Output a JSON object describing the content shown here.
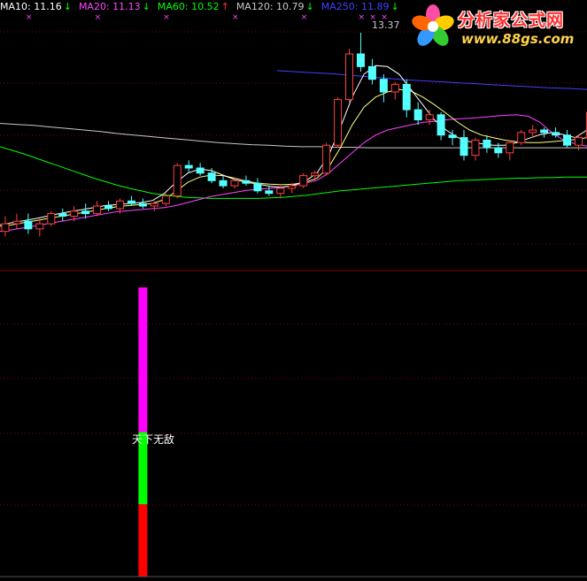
{
  "legend": [
    {
      "label": "MA10: 11.16",
      "arrow": "↓",
      "color": "#ffffff",
      "arrow_color": "#00ff00"
    },
    {
      "label": "MA20: 11.13",
      "arrow": "↓",
      "color": "#ff44ff",
      "arrow_color": "#00ff00"
    },
    {
      "label": "MA60: 10.52",
      "arrow": "↑",
      "color": "#00ff00",
      "arrow_color": "#ff3030"
    },
    {
      "label": "MA120: 10.79",
      "arrow": "↓",
      "color": "#c8c8c8",
      "arrow_color": "#00ff00"
    },
    {
      "label": "MA250: 11.89",
      "arrow": "↓",
      "color": "#4040ff",
      "arrow_color": "#00ff00"
    }
  ],
  "logo": {
    "title": "分析家公式网",
    "url": "www.88gs.com",
    "icon": "flower-logo-icon"
  },
  "colors": {
    "background": "#000000",
    "grid": "#8b0000",
    "up_candle": "#ff4040",
    "down_candle": "#54ffff",
    "ma_short": "#ffffff",
    "ma_yellow": "#ffff80",
    "ma20": "#ff44ff",
    "ma60": "#00ff00",
    "ma120": "#c8c8c8",
    "ma250": "#4040ff",
    "bar_magenta": "#ff00ff",
    "bar_green": "#00ff00",
    "bar_red": "#ff0000"
  },
  "chart_data": [
    {
      "type": "candlestick",
      "peak_label": "13.37",
      "y_range": [
        9.2,
        13.7
      ],
      "candles": [
        {
          "o": 9.45,
          "h": 9.75,
          "l": 9.35,
          "c": 9.6
        },
        {
          "o": 9.6,
          "h": 9.8,
          "l": 9.5,
          "c": 9.65
        },
        {
          "o": 9.65,
          "h": 9.8,
          "l": 9.4,
          "c": 9.5
        },
        {
          "o": 9.5,
          "h": 9.7,
          "l": 9.35,
          "c": 9.6
        },
        {
          "o": 9.6,
          "h": 9.85,
          "l": 9.55,
          "c": 9.8
        },
        {
          "o": 9.8,
          "h": 9.9,
          "l": 9.65,
          "c": 9.75
        },
        {
          "o": 9.75,
          "h": 9.95,
          "l": 9.65,
          "c": 9.85
        },
        {
          "o": 9.85,
          "h": 10.0,
          "l": 9.7,
          "c": 9.8
        },
        {
          "o": 9.8,
          "h": 10.05,
          "l": 9.75,
          "c": 9.95
        },
        {
          "o": 9.95,
          "h": 10.05,
          "l": 9.85,
          "c": 9.9
        },
        {
          "o": 9.9,
          "h": 10.1,
          "l": 9.8,
          "c": 10.05
        },
        {
          "o": 10.05,
          "h": 10.15,
          "l": 9.95,
          "c": 10.0
        },
        {
          "o": 10.0,
          "h": 10.1,
          "l": 9.9,
          "c": 9.95
        },
        {
          "o": 9.95,
          "h": 10.05,
          "l": 9.85,
          "c": 10.0
        },
        {
          "o": 10.0,
          "h": 10.2,
          "l": 9.95,
          "c": 10.15
        },
        {
          "o": 10.15,
          "h": 10.8,
          "l": 10.1,
          "c": 10.75
        },
        {
          "o": 10.75,
          "h": 10.85,
          "l": 10.6,
          "c": 10.7
        },
        {
          "o": 10.7,
          "h": 10.8,
          "l": 10.55,
          "c": 10.6
        },
        {
          "o": 10.6,
          "h": 10.7,
          "l": 10.4,
          "c": 10.45
        },
        {
          "o": 10.45,
          "h": 10.55,
          "l": 10.3,
          "c": 10.35
        },
        {
          "o": 10.35,
          "h": 10.5,
          "l": 10.3,
          "c": 10.45
        },
        {
          "o": 10.45,
          "h": 10.55,
          "l": 10.35,
          "c": 10.4
        },
        {
          "o": 10.4,
          "h": 10.5,
          "l": 10.2,
          "c": 10.25
        },
        {
          "o": 10.25,
          "h": 10.35,
          "l": 10.15,
          "c": 10.2
        },
        {
          "o": 10.2,
          "h": 10.35,
          "l": 10.1,
          "c": 10.3
        },
        {
          "o": 10.3,
          "h": 10.4,
          "l": 10.2,
          "c": 10.35
        },
        {
          "o": 10.35,
          "h": 10.6,
          "l": 10.3,
          "c": 10.55
        },
        {
          "o": 10.55,
          "h": 10.65,
          "l": 10.45,
          "c": 10.6
        },
        {
          "o": 10.6,
          "h": 11.2,
          "l": 10.55,
          "c": 11.15
        },
        {
          "o": 11.15,
          "h": 12.1,
          "l": 11.1,
          "c": 12.05
        },
        {
          "o": 12.05,
          "h": 13.05,
          "l": 12.0,
          "c": 12.95
        },
        {
          "o": 12.95,
          "h": 13.37,
          "l": 12.6,
          "c": 12.7
        },
        {
          "o": 12.7,
          "h": 12.85,
          "l": 12.35,
          "c": 12.45
        },
        {
          "o": 12.45,
          "h": 12.55,
          "l": 12.0,
          "c": 12.2
        },
        {
          "o": 12.2,
          "h": 12.4,
          "l": 12.05,
          "c": 12.35
        },
        {
          "o": 12.35,
          "h": 12.45,
          "l": 11.7,
          "c": 11.85
        },
        {
          "o": 11.85,
          "h": 12.0,
          "l": 11.55,
          "c": 11.65
        },
        {
          "o": 11.65,
          "h": 11.85,
          "l": 11.55,
          "c": 11.75
        },
        {
          "o": 11.75,
          "h": 11.8,
          "l": 11.25,
          "c": 11.35
        },
        {
          "o": 11.35,
          "h": 11.45,
          "l": 11.15,
          "c": 11.3
        },
        {
          "o": 11.3,
          "h": 11.45,
          "l": 10.85,
          "c": 10.95
        },
        {
          "o": 10.95,
          "h": 11.3,
          "l": 10.85,
          "c": 11.25
        },
        {
          "o": 11.25,
          "h": 11.35,
          "l": 11.0,
          "c": 11.1
        },
        {
          "o": 11.1,
          "h": 11.2,
          "l": 10.9,
          "c": 11.0
        },
        {
          "o": 11.0,
          "h": 11.25,
          "l": 10.85,
          "c": 11.2
        },
        {
          "o": 11.2,
          "h": 11.45,
          "l": 11.15,
          "c": 11.4
        },
        {
          "o": 11.4,
          "h": 11.55,
          "l": 11.3,
          "c": 11.45
        },
        {
          "o": 11.45,
          "h": 11.5,
          "l": 11.3,
          "c": 11.4
        },
        {
          "o": 11.4,
          "h": 11.5,
          "l": 11.3,
          "c": 11.35
        },
        {
          "o": 11.35,
          "h": 11.45,
          "l": 11.1,
          "c": 11.15
        },
        {
          "o": 11.15,
          "h": 11.35,
          "l": 11.05,
          "c": 11.3
        },
        {
          "o": 11.3,
          "h": 11.85,
          "l": 11.25,
          "c": 11.8
        }
      ],
      "ma_series": [
        {
          "key": "ma250",
          "values": [
            12.62,
            12.6,
            12.58,
            12.56,
            12.53,
            12.5,
            12.47,
            12.44,
            12.42,
            12.4,
            12.38,
            12.36,
            12.34,
            12.32,
            12.3,
            12.28,
            12.27,
            12.25
          ]
        },
        {
          "key": "ma120",
          "values": [
            11.58,
            11.56,
            11.54,
            11.51,
            11.48,
            11.45,
            11.42,
            11.38,
            11.35,
            11.32,
            11.29,
            11.26,
            11.23,
            11.2,
            11.18,
            11.16,
            11.15,
            11.13,
            11.12,
            11.12,
            11.11,
            11.11,
            11.1,
            11.1,
            11.1,
            11.1,
            11.1,
            11.1,
            11.1,
            11.1,
            11.1,
            11.1,
            11.1,
            11.1,
            11.1,
            11.1
          ]
        },
        {
          "key": "ma60",
          "values": [
            11.12,
            11.05,
            10.98,
            10.9,
            10.82,
            10.74,
            10.66,
            10.58,
            10.5,
            10.43,
            10.36,
            10.3,
            10.25,
            10.2,
            10.17,
            10.14,
            10.12,
            10.11,
            10.1,
            10.1,
            10.1,
            10.1,
            10.1,
            10.11,
            10.12,
            10.14,
            10.16,
            10.19,
            10.22,
            10.25,
            10.27,
            10.29,
            10.31,
            10.33,
            10.35,
            10.37,
            10.39,
            10.41,
            10.43,
            10.45,
            10.46,
            10.47,
            10.48,
            10.49,
            10.5,
            10.5,
            10.51,
            10.51,
            10.52,
            10.52,
            10.52
          ]
        },
        {
          "key": "ma20",
          "values": [
            9.45,
            9.48,
            9.52,
            9.56,
            9.6,
            9.64,
            9.68,
            9.72,
            9.76,
            9.8,
            9.84,
            9.86,
            9.88,
            9.9,
            9.92,
            9.96,
            10.02,
            10.08,
            10.14,
            10.18,
            10.22,
            10.26,
            10.28,
            10.3,
            10.32,
            10.35,
            10.4,
            10.46,
            10.6,
            10.8,
            11.0,
            11.2,
            11.35,
            11.45,
            11.5,
            11.55,
            11.6,
            11.62,
            11.65,
            11.67,
            11.68,
            11.7,
            11.72,
            11.74,
            11.75,
            11.72,
            11.6,
            11.4,
            11.25,
            11.18,
            11.13
          ]
        },
        {
          "key": "ma_yellow",
          "values": [
            9.55,
            9.58,
            9.62,
            9.66,
            9.7,
            9.74,
            9.78,
            9.82,
            9.86,
            9.9,
            9.94,
            9.96,
            9.98,
            10.0,
            10.08,
            10.24,
            10.42,
            10.52,
            10.56,
            10.55,
            10.5,
            10.44,
            10.4,
            10.38,
            10.37,
            10.38,
            10.42,
            10.5,
            10.72,
            11.1,
            11.55,
            11.9,
            12.1,
            12.2,
            12.25,
            12.22,
            12.1,
            11.95,
            11.78,
            11.6,
            11.45,
            11.35,
            11.3,
            11.25,
            11.22,
            11.2,
            11.2,
            11.22,
            11.24,
            11.26,
            11.3
          ]
        },
        {
          "key": "ma_short",
          "values": [
            9.58,
            9.62,
            9.66,
            9.7,
            9.75,
            9.8,
            9.84,
            9.88,
            9.92,
            9.96,
            9.98,
            10.0,
            10.02,
            10.06,
            10.2,
            10.42,
            10.6,
            10.68,
            10.65,
            10.56,
            10.47,
            10.42,
            10.38,
            10.34,
            10.32,
            10.36,
            10.44,
            10.6,
            10.95,
            11.5,
            12.1,
            12.55,
            12.72,
            12.7,
            12.55,
            12.25,
            11.95,
            11.65,
            11.45,
            11.3,
            11.22,
            11.18,
            11.15,
            11.15,
            11.2,
            11.28,
            11.36,
            11.4,
            11.36,
            11.3,
            11.45
          ]
        }
      ],
      "ma_legend_order": [
        "ma_short",
        "ma20",
        "ma60",
        "ma120",
        "ma250"
      ],
      "markers_x_index": [
        2,
        8,
        14,
        20,
        26,
        31,
        32,
        33
      ]
    },
    {
      "type": "bar",
      "signal_label": "天下无敌",
      "bar_index": 12,
      "segments": [
        {
          "color_key": "bar_red",
          "value": 1.0
        },
        {
          "color_key": "bar_green",
          "value": 1.0
        },
        {
          "color_key": "bar_magenta",
          "value": 2.0
        }
      ],
      "y_range": [
        0,
        4.0
      ]
    }
  ]
}
